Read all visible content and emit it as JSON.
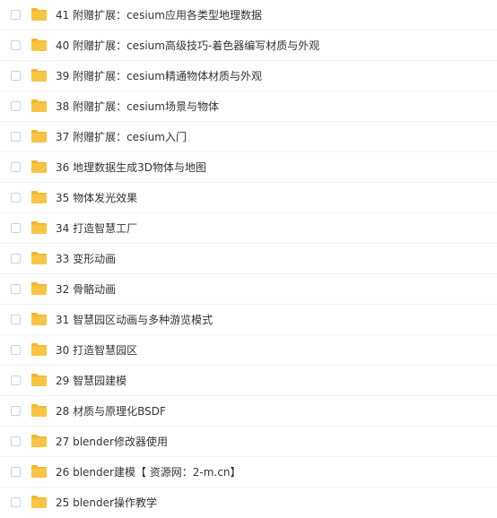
{
  "folder_color": "#f7c546",
  "folder_tab_color": "#f2b62e",
  "items": [
    {
      "label": "41 附赠扩展：cesium应用各类型地理数据"
    },
    {
      "label": "40 附赠扩展：cesium高级技巧-着色器编写材质与外观"
    },
    {
      "label": "39 附赠扩展：cesium精通物体材质与外观"
    },
    {
      "label": "38 附赠扩展：cesium场景与物体"
    },
    {
      "label": "37 附赠扩展：cesium入门"
    },
    {
      "label": "36 地理数据生成3D物体与地图"
    },
    {
      "label": "35 物体发光效果"
    },
    {
      "label": "34 打造智慧工厂"
    },
    {
      "label": "33 变形动画"
    },
    {
      "label": "32 骨骼动画"
    },
    {
      "label": "31 智慧园区动画与多种游览模式"
    },
    {
      "label": "30 打造智慧园区"
    },
    {
      "label": "29 智慧园建模"
    },
    {
      "label": "28 材质与原理化BSDF"
    },
    {
      "label": "27 blender修改器使用"
    },
    {
      "label": "26 blender建模【 资源网：2-m.cn】"
    },
    {
      "label": "25 blender操作教学"
    }
  ]
}
